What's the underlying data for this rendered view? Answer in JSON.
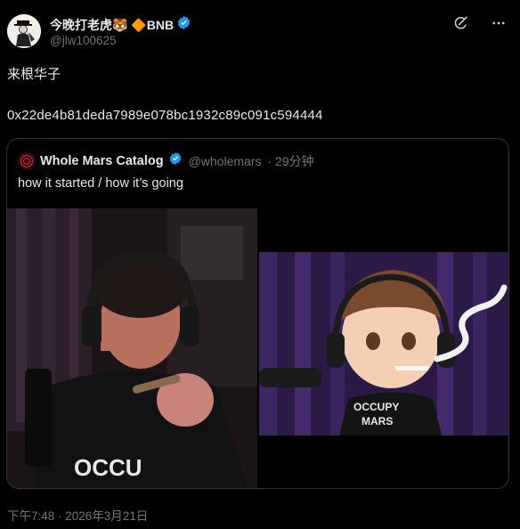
{
  "author": {
    "display_name": "今晚打老虎🐯 🔶BNB",
    "handle": "@jlw100625",
    "verified": true,
    "accent_color": "#1d9bf0"
  },
  "actions": {
    "grok_icon": "grok-icon",
    "more_icon": "more-icon"
  },
  "post": {
    "line1": "来根华子",
    "line2": "0x22de4b81deda7989e078bc1932c89c091c594444"
  },
  "quote": {
    "display_name": "Whole Mars Catalog",
    "handle": "@wholemars",
    "time": "· 29分钟",
    "text": "how it started / how it’s going",
    "verified": true,
    "image_left_shirt_text": "OCCU",
    "image_right_shirt_text": "OCCUPY\nMARS"
  },
  "timestamp": "下午7:48 · 2026年3月21日"
}
